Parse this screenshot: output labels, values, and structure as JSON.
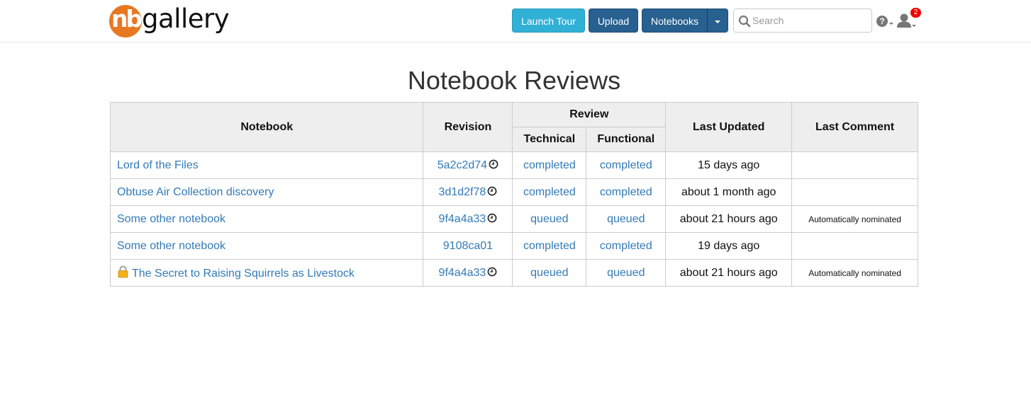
{
  "navbar": {
    "logo_mark": "nb",
    "logo_text": "gallery",
    "launch_tour": "Launch Tour",
    "upload": "Upload",
    "notebooks": "Notebooks",
    "search_placeholder": "Search",
    "notification_count": "2"
  },
  "page": {
    "title": "Notebook Reviews"
  },
  "table": {
    "headers": {
      "notebook": "Notebook",
      "revision": "Revision",
      "review": "Review",
      "technical": "Technical",
      "functional": "Functional",
      "last_updated": "Last Updated",
      "last_comment": "Last Comment"
    },
    "rows": [
      {
        "notebook": "Lord of the Files",
        "revision": "5a2c2d74",
        "technical": "completed",
        "functional": "completed",
        "last_updated": "15 days ago",
        "last_comment": ""
      },
      {
        "notebook": "Obtuse Air Collection discovery",
        "revision": "3d1d2f78",
        "technical": "completed",
        "functional": "completed",
        "last_updated": "about 1 month ago",
        "last_comment": ""
      },
      {
        "notebook": "Some other notebook",
        "revision": "9f4a4a33",
        "technical": "queued",
        "functional": "queued",
        "last_updated": "about 21 hours ago",
        "last_comment": "Automatically nominated"
      },
      {
        "notebook": "Some other notebook",
        "revision": "9108ca01",
        "technical": "completed",
        "functional": "completed",
        "last_updated": "19 days ago",
        "last_comment": ""
      },
      {
        "notebook": "The Secret to Raising Squirrels as Livestock",
        "revision": "9f4a4a33",
        "technical": "queued",
        "functional": "queued",
        "last_updated": "about 21 hours ago",
        "last_comment": "Automatically nominated"
      }
    ]
  },
  "colors": {
    "link": "#337ab7",
    "tour_button": "#31b0d5",
    "primary_button": "#286090",
    "logo_orange": "#e87722",
    "badge_red": "#ee0000"
  }
}
